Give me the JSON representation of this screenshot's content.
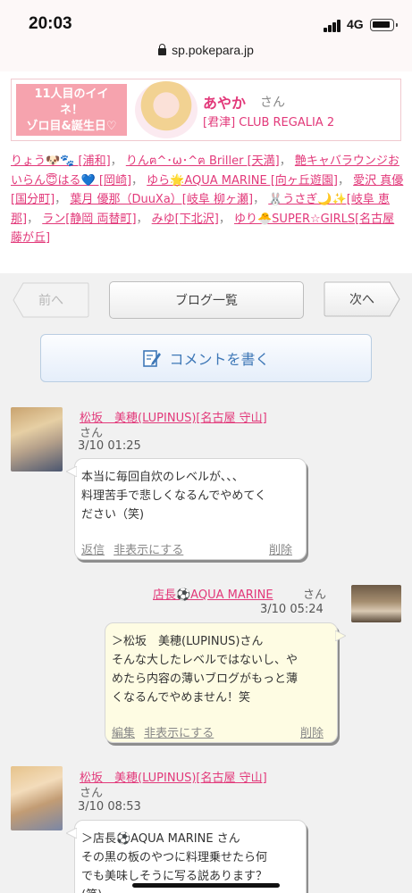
{
  "status": {
    "time": "20:03",
    "network": "4G",
    "url": "sp.pokepara.jp"
  },
  "banner": {
    "promo_line1": "11人目のイイ",
    "promo_line2": "ネ！",
    "promo_line3": "ゾロ目&誕生日♡",
    "name": "あやか",
    "san": "さん",
    "shop": "[君津] CLUB REGALIA 2"
  },
  "links": [
    "りょう🐶🐾 [浦和]",
    "りんฅ^･ω･^ฅ Briller [天満]",
    "艶キャバラウンジおいらん😇はる💙 [岡崎]",
    "ゆら🌟AQUA MARINE [向ヶ丘遊園]",
    "愛沢 真優[国分町]",
    "葉月 優那（DuuXa）[岐阜 柳ヶ瀬]",
    "🐰うさぎ🌙✨[岐阜 恵那]",
    "ラン[静岡 両替町]",
    "みゆ[下北沢]",
    "ゆり🐣SUPER☆GIRLS[名古屋 藤が丘]"
  ],
  "nav": {
    "prev": "前へ",
    "list": "ブログ一覧",
    "next": "次へ",
    "comment": "コメントを書く"
  },
  "comments": [
    {
      "author": "松坂　美穂(LUPINUS)[名古屋 守山]",
      "san": "さん",
      "date": "3/10 01:25",
      "lines": [
        "本当に毎回自炊のレベルが、、、",
        "料理苦手で悲しくなるんでやめてく",
        "ださい（笑)"
      ],
      "actions": [
        "返信",
        "非表示にする",
        "削除"
      ]
    },
    {
      "author": "店長⚽AQUA MARINE",
      "san": "さん",
      "date": "3/10 05:24",
      "lines": [
        "＞松坂　美穂(LUPINUS)さん",
        "そんな大したレベルではないし、や",
        "めたら内容の薄いブログがもっと薄",
        "くなるんでやめません！笑"
      ],
      "actions": [
        "編集",
        "非表示にする",
        "削除"
      ]
    },
    {
      "author": "松坂　美穂(LUPINUS)[名古屋 守山]",
      "san": "さん",
      "date": "3/10 08:53",
      "lines": [
        "＞店長⚽AQUA MARINE さん",
        "その黒の板のやつに料理乗せたら何",
        "でも美味しそうに写る説あります？",
        "(笑)"
      ],
      "actions": []
    }
  ],
  "colors": {
    "accent": "#e2397a",
    "promo": "#f6a3ae",
    "panel": "#f1f1f1",
    "link_blue": "#3f78b7"
  }
}
